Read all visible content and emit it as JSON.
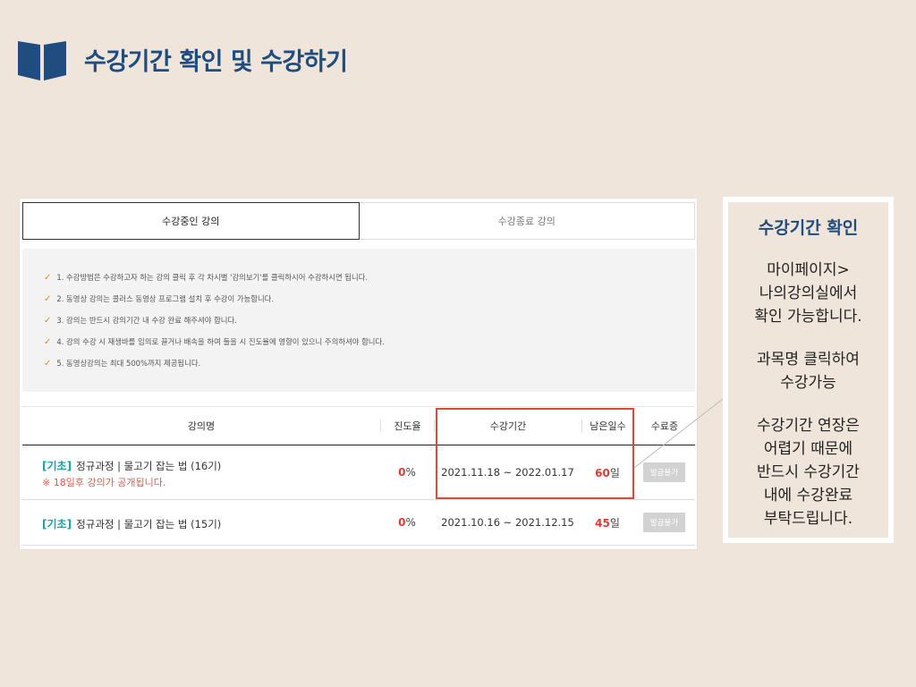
{
  "header": {
    "title": "수강기간 확인 및 수강하기",
    "icon": "book-icon"
  },
  "tabs": [
    {
      "label": "수강중인 강의"
    },
    {
      "label": "수강종료 강의"
    }
  ],
  "notices": [
    "1. 수강방법은 수강하고자 하는 강의 클릭 후 각 차시별 '강의보기'를 클릭하시어 수강하시면 됩니다.",
    "2. 동영상 강의는 콜러스 동영상 프로그램 설치 후 수강이 가능합니다.",
    "3. 강의는 반드시 강의기간 내 수강 완료 해주셔야 합니다.",
    "4. 강의 수강 시 재생바를 임의로 끌거나 배속을 하여 들을 시 진도율에 영향이 있으니 주의하셔야 합니다.",
    "5. 동영상강의는 최대 500%까지 제공됩니다."
  ],
  "table": {
    "headers": [
      "강의명",
      "진도율",
      "수강기간",
      "남은일수",
      "수료증"
    ],
    "rows": [
      {
        "tag": "[기초]",
        "name": "정규과정 | 물고기 잡는 법 (16기)",
        "warning": "※ 18일후 강의가 공개됩니다.",
        "progress_value": "0",
        "progress_unit": "%",
        "period": "2021.11.18 ~ 2022.01.17",
        "days_value": "60",
        "days_unit": "일",
        "cert": "발급불가"
      },
      {
        "tag": "[기초]",
        "name": "정규과정 | 물고기 잡는 법 (15기)",
        "warning": "",
        "progress_value": "0",
        "progress_unit": "%",
        "period": "2021.10.16 ~ 2021.12.15",
        "days_value": "45",
        "days_unit": "일",
        "cert": "발급불가"
      }
    ]
  },
  "side": {
    "title": "수강기간 확인",
    "p1": [
      "마이페이지>",
      "나의강의실에서",
      "확인 가능합니다."
    ],
    "p2": [
      "과목명 클릭하여",
      "수강가능"
    ],
    "p3": [
      "수강기간 연장은",
      "어렵기 때문에",
      "반드시 수강기간",
      "내에 수강완료",
      "부탁드립니다."
    ]
  },
  "colors": {
    "title": "#1f4d80",
    "accent_red": "#d9493c",
    "tag": "#1aa3a0",
    "background": "#efe5da"
  }
}
